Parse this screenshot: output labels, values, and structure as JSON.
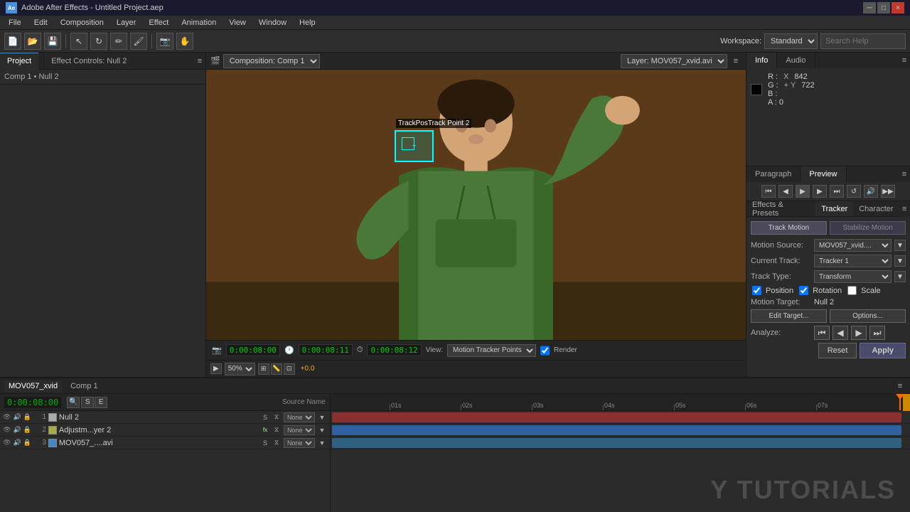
{
  "title_bar": {
    "title": "Adobe After Effects - Untitled Project.aep",
    "logo": "Ae",
    "controls": [
      "_",
      "□",
      "×"
    ]
  },
  "menu": {
    "items": [
      "File",
      "Edit",
      "Composition",
      "Layer",
      "Effect",
      "Animation",
      "View",
      "Window",
      "Help"
    ]
  },
  "toolbar": {
    "workspace_label": "Workspace:",
    "workspace_value": "Standard",
    "search_placeholder": "Search Help"
  },
  "left_panel": {
    "tab": "Project",
    "effect_controls_label": "Effect Controls: Null 2",
    "breadcrumb": "Comp 1 • Null 2"
  },
  "comp_panel": {
    "comp_label": "Composition: Comp 1",
    "layer_label": "Layer: MOV057_xvid.avi",
    "time_current": "0:00:08:00",
    "time_display1": "0:00:08:00",
    "time_display2": "0:00:08:11",
    "time_duration": "0:00:08:12",
    "zoom": "50%",
    "view_label": "View:",
    "view_option": "Motion Tracker Points",
    "render_label": "Render",
    "tracker_label": "Track Point 2",
    "tracker_sub": "TrackPosTrack Point 2"
  },
  "info_panel": {
    "tab_info": "Info",
    "tab_audio": "Audio",
    "r_label": "R :",
    "g_label": "G :",
    "b_label": "B :",
    "a_label": "A :",
    "a_value": "0",
    "x_label": "X",
    "x_value": "842",
    "y_label": "Y",
    "y_value": "722"
  },
  "preview_panel": {
    "tab_paragraph": "Paragraph",
    "tab_preview": "Preview"
  },
  "tracker_panel": {
    "tab_effects": "Effects & Presets",
    "tab_tracker": "Tracker",
    "tab_character": "Character",
    "track_motion_btn": "Track Motion",
    "stabilize_motion_btn": "Stabilize Motion",
    "motion_source_label": "Motion Source:",
    "motion_source_value": "MOV057_xvid....",
    "current_track_label": "Current Track:",
    "current_track_value": "Tracker 1",
    "track_type_label": "Track Type:",
    "track_type_value": "Transform",
    "position_label": "Position",
    "rotation_label": "Rotation",
    "scale_label": "Scale",
    "motion_target_label": "Motion Target:",
    "motion_target_value": "Null 2",
    "edit_target_btn": "Edit Target...",
    "options_btn": "Options...",
    "analyze_label": "Analyze:",
    "reset_btn": "Reset",
    "apply_btn": "Apply"
  },
  "timeline": {
    "tab_source": "MOV057_xvid",
    "tab_comp": "Comp 1",
    "time_code": "0:00:08:00",
    "layers": [
      {
        "num": "1",
        "name": "Null 2",
        "color": "#aaaaaa",
        "parent": "None",
        "has_fx": false
      },
      {
        "num": "2",
        "name": "Adjustm...yer 2",
        "color": "#aaaa00",
        "parent": "None",
        "has_fx": true
      },
      {
        "num": "3",
        "name": "MOV057_....avi",
        "color": "#4488cc",
        "parent": "None",
        "has_fx": false
      }
    ],
    "ruler_marks": [
      "01s",
      "02s",
      "03s",
      "04s",
      "05s",
      "06s",
      "07s"
    ],
    "playhead_pos": "0"
  },
  "watermark": "Y TUTORIALS"
}
